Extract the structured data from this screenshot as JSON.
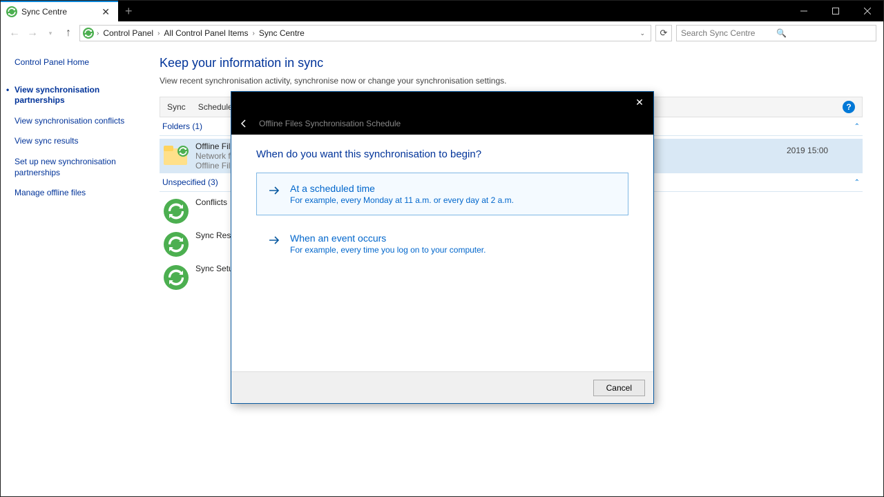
{
  "tab": {
    "title": "Sync Centre"
  },
  "breadcrumb": [
    "Control Panel",
    "All Control Panel Items",
    "Sync Centre"
  ],
  "search": {
    "placeholder": "Search Sync Centre"
  },
  "sidebar": {
    "home": "Control Panel Home",
    "items": [
      "View synchronisation partnerships",
      "View synchronisation conflicts",
      "View sync results",
      "Set up new synchronisation partnerships",
      "Manage offline files"
    ]
  },
  "main": {
    "title": "Keep your information in sync",
    "desc": "View recent synchronisation activity, synchronise now or change your synchronisation settings.",
    "toolbar": {
      "sync": "Sync",
      "schedule": "Schedule"
    },
    "group_folders": "Folders (1)",
    "group_unspec": "Unspecified (3)",
    "offline": {
      "name": "Offline Files",
      "sub1": "Network files",
      "sub2": "Offline Files a"
    },
    "conflicts": "Conflicts",
    "results": "Sync Results",
    "setup": "Sync Setup",
    "date_part": "2019 15:00"
  },
  "dialog": {
    "subtitle": "Offline Files Synchronisation Schedule",
    "question": "When do you want this synchronisation to begin?",
    "opt1": {
      "title": "At a scheduled time",
      "desc": "For example, every Monday at 11 a.m. or every day at 2 a.m."
    },
    "opt2": {
      "title": "When an event occurs",
      "desc": "For example, every time you log on to your computer."
    },
    "cancel": "Cancel"
  }
}
